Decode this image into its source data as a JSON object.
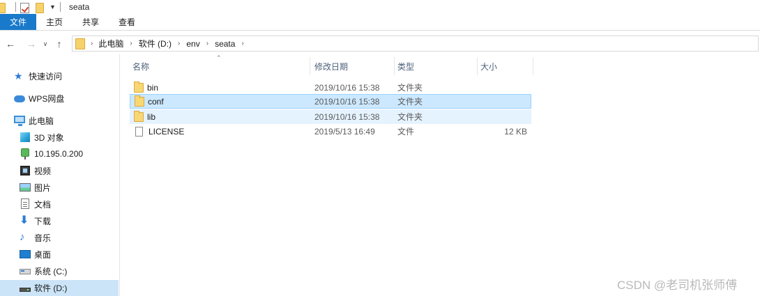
{
  "window": {
    "title": "seata"
  },
  "ribbon": {
    "tabs": [
      "文件",
      "主页",
      "共享",
      "查看"
    ]
  },
  "address": {
    "crumbs": [
      "此电脑",
      "软件 (D:)",
      "env",
      "seata"
    ]
  },
  "sidebar": {
    "items": [
      {
        "label": "快速访问",
        "icon": "star-icon"
      },
      {
        "label": "WPS网盘",
        "icon": "cloud-icon"
      },
      {
        "label": "此电脑",
        "icon": "computer-icon"
      },
      {
        "label": "3D 对象",
        "icon": "cube-icon"
      },
      {
        "label": "10.195.0.200",
        "icon": "network-location-icon"
      },
      {
        "label": "视频",
        "icon": "video-icon"
      },
      {
        "label": "图片",
        "icon": "pictures-icon"
      },
      {
        "label": "文档",
        "icon": "documents-icon"
      },
      {
        "label": "下载",
        "icon": "download-icon"
      },
      {
        "label": "音乐",
        "icon": "music-icon"
      },
      {
        "label": "桌面",
        "icon": "desktop-icon"
      },
      {
        "label": "系统 (C:)",
        "icon": "drive-c-icon"
      },
      {
        "label": "软件 (D:)",
        "icon": "drive-d-icon",
        "selected": true
      }
    ]
  },
  "columns": {
    "name": "名称",
    "date": "修改日期",
    "type": "类型",
    "size": "大小"
  },
  "files": [
    {
      "name": "bin",
      "date": "2019/10/16 15:38",
      "type": "文件夹",
      "size": "",
      "kind": "folder"
    },
    {
      "name": "conf",
      "date": "2019/10/16 15:38",
      "type": "文件夹",
      "size": "",
      "kind": "folder",
      "state": "selected"
    },
    {
      "name": "lib",
      "date": "2019/10/16 15:38",
      "type": "文件夹",
      "size": "",
      "kind": "folder",
      "state": "hover"
    },
    {
      "name": "LICENSE",
      "date": "2019/5/13 16:49",
      "type": "文件",
      "size": "12 KB",
      "kind": "file"
    }
  ],
  "watermark": "CSDN @老司机张师傅"
}
